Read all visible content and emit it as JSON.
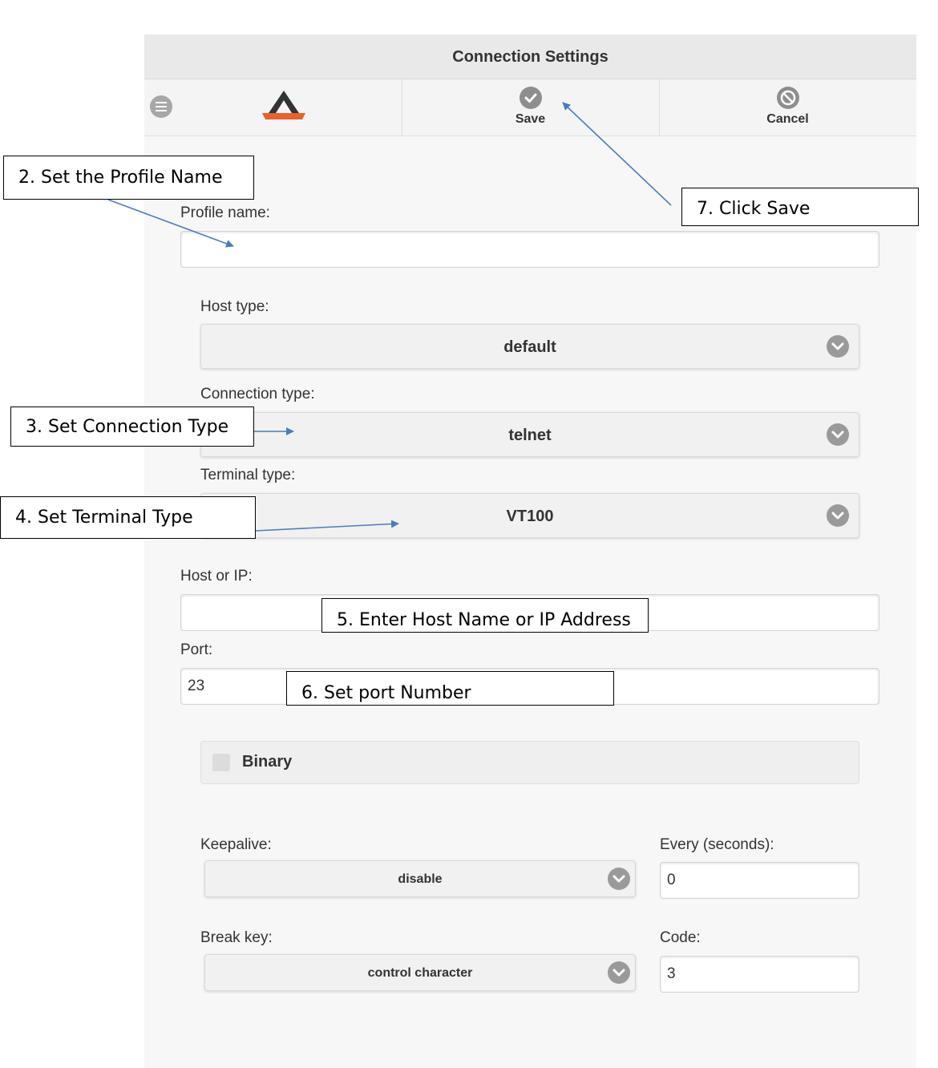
{
  "window": {
    "title": "Connection Settings"
  },
  "toolbar": {
    "menu_icon": "menu-icon",
    "logo_icon": "app-logo-icon",
    "save": {
      "label": "Save",
      "icon": "check-icon"
    },
    "cancel": {
      "label": "Cancel",
      "icon": "cancel-icon"
    }
  },
  "form": {
    "profile_name": {
      "label": "Profile name:",
      "value": ""
    },
    "host_type": {
      "label": "Host type:",
      "value": "default"
    },
    "connection_type": {
      "label": "Connection type:",
      "value": "telnet"
    },
    "terminal_type": {
      "label": "Terminal type:",
      "value": "VT100"
    },
    "host": {
      "label": "Host or IP:",
      "value": ""
    },
    "port": {
      "label": "Port:",
      "value": "23"
    },
    "binary": {
      "label": "Binary",
      "checked": false
    },
    "keepalive": {
      "label": "Keepalive:",
      "value": "disable"
    },
    "every": {
      "label": "Every (seconds):",
      "value": "0"
    },
    "break_key": {
      "label": "Break key:",
      "value": "control character"
    },
    "code": {
      "label": "Code:",
      "value": "3"
    }
  },
  "annotations": {
    "step2": "2. Set the Profile Name",
    "step3": "3. Set Connection Type",
    "step4": "4. Set Terminal Type",
    "step5": "5. Enter Host Name or IP Address",
    "step6": "6. Set port Number",
    "step7": "7. Click Save"
  },
  "colors": {
    "logo_orange": "#e8622a",
    "logo_dark": "#333333",
    "annotation_arrow": "#4a7ebb"
  }
}
